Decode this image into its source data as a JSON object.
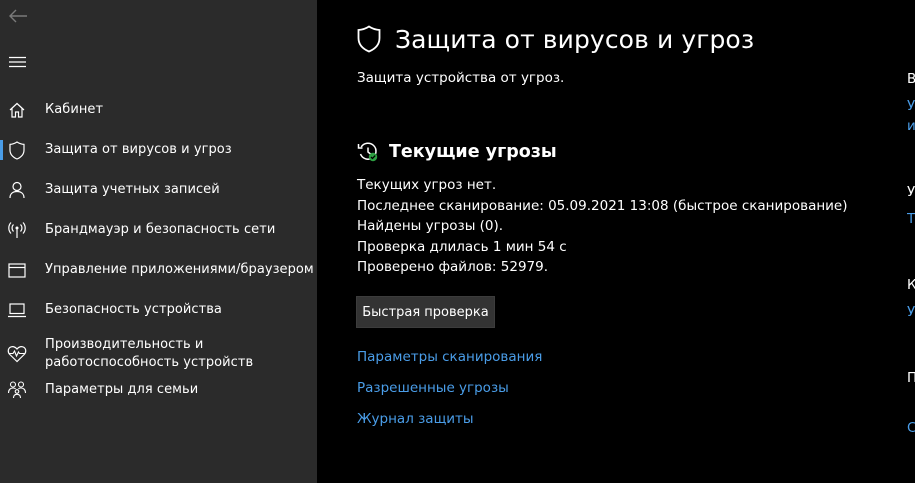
{
  "sidebar": {
    "items": [
      {
        "label": "Кабинет",
        "icon": "home-icon"
      },
      {
        "label": "Защита от вирусов и угроз",
        "icon": "shield-icon",
        "selected": true
      },
      {
        "label": "Защита учетных записей",
        "icon": "person-icon"
      },
      {
        "label": "Брандмауэр и безопасность сети",
        "icon": "antenna-icon"
      },
      {
        "label": "Управление приложениями/браузером",
        "icon": "app-window-icon"
      },
      {
        "label": "Безопасность устройства",
        "icon": "laptop-icon"
      },
      {
        "label": "Производительность и работоспособность устройств",
        "icon": "heart-pulse-icon"
      },
      {
        "label": "Параметры для семьи",
        "icon": "family-icon"
      }
    ]
  },
  "main": {
    "title": "Защита от вирусов и угроз",
    "subtitle": "Защита устройства от угроз.",
    "current_threats": {
      "title": "Текущие угрозы",
      "lines": [
        "Текущих угроз нет.",
        "Последнее сканирование: 05.09.2021 13:08 (быстрое сканирование)",
        "Найдены угрозы (0).",
        "Проверка длилась 1 мин 54 с",
        "Проверено файлов: 52979."
      ],
      "quick_scan_label": "Быстрая проверка"
    },
    "links": {
      "scan_options": "Параметры сканирования",
      "allowed_threats": "Разрешенные угрозы",
      "protection_history": "Журнал защиты"
    }
  },
  "right_column": {
    "fragments": [
      "В",
      "У",
      "и",
      "У",
      "Т",
      "К",
      "У",
      "П",
      "С"
    ]
  },
  "colors": {
    "sidebar_bg": "#2b2b2b",
    "main_bg": "#000000",
    "accent": "#4a9de8",
    "status_ok": "#2ea043"
  }
}
